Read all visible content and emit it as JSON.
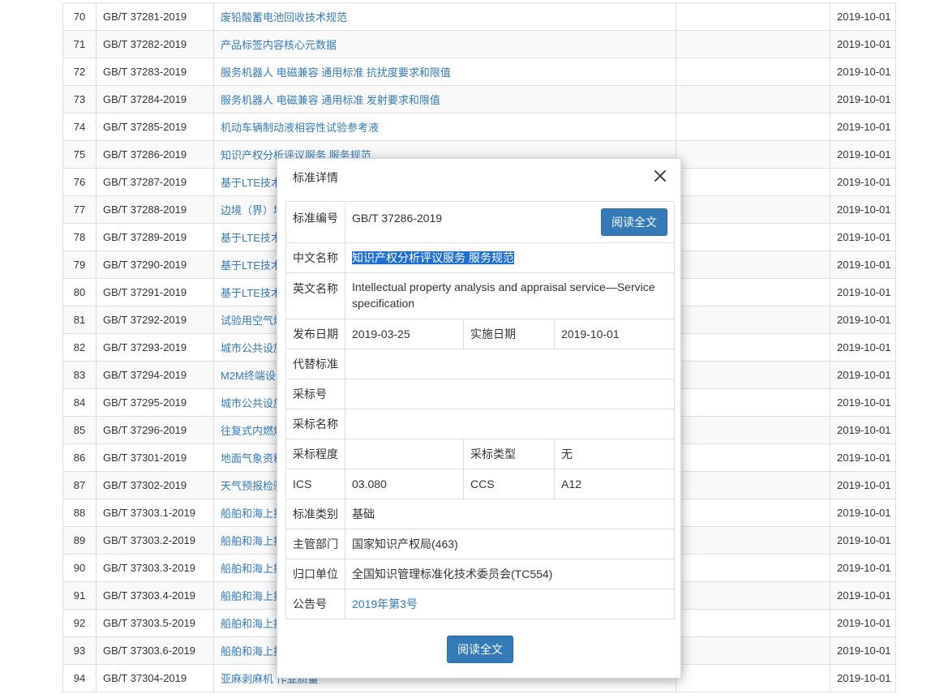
{
  "rows": [
    {
      "no": "70",
      "code": "GB/T 37281-2019",
      "name": "废铅酸蓄电池回收技术规范",
      "date": "2019-10-01"
    },
    {
      "no": "71",
      "code": "GB/T 37282-2019",
      "name": "产品标签内容核心元数据",
      "date": "2019-10-01"
    },
    {
      "no": "72",
      "code": "GB/T 37283-2019",
      "name": "服务机器人 电磁兼容 通用标准 抗扰度要求和限值",
      "date": "2019-10-01"
    },
    {
      "no": "73",
      "code": "GB/T 37284-2019",
      "name": "服务机器人 电磁兼容 通用标准 发射要求和限值",
      "date": "2019-10-01"
    },
    {
      "no": "74",
      "code": "GB/T 37285-2019",
      "name": "机动车辆制动液相容性试验参考液",
      "date": "2019-10-01"
    },
    {
      "no": "75",
      "code": "GB/T 37286-2019",
      "name": "知识产权分析评议服务 服务规范",
      "date": "2019-10-01"
    },
    {
      "no": "76",
      "code": "GB/T 37287-2019",
      "name": "基于LTE技术",
      "date": "2019-10-01"
    },
    {
      "no": "77",
      "code": "GB/T 37288-2019",
      "name": "边境（界）地",
      "date": "2019-10-01"
    },
    {
      "no": "78",
      "code": "GB/T 37289-2019",
      "name": "基于LTE技术",
      "date": "2019-10-01"
    },
    {
      "no": "79",
      "code": "GB/T 37290-2019",
      "name": "基于LTE技术",
      "date": "2019-10-01"
    },
    {
      "no": "80",
      "code": "GB/T 37291-2019",
      "name": "基于LTE技术",
      "date": "2019-10-01"
    },
    {
      "no": "81",
      "code": "GB/T 37292-2019",
      "name": "试验用空气焓",
      "date": "2019-10-01"
    },
    {
      "no": "82",
      "code": "GB/T 37293-2019",
      "name": "城市公共设施",
      "date": "2019-10-01"
    },
    {
      "no": "83",
      "code": "GB/T 37294-2019",
      "name": "M2M终端设备",
      "date": "2019-10-01"
    },
    {
      "no": "84",
      "code": "GB/T 37295-2019",
      "name": "城市公共设施",
      "date": "2019-10-01"
    },
    {
      "no": "85",
      "code": "GB/T 37296-2019",
      "name": "往复式内燃燃",
      "date": "2019-10-01"
    },
    {
      "no": "86",
      "code": "GB/T 37301-2019",
      "name": "地面气象资料",
      "date": "2019-10-01"
    },
    {
      "no": "87",
      "code": "GB/T 37302-2019",
      "name": "天气预报检验",
      "date": "2019-10-01"
    },
    {
      "no": "88",
      "code": "GB/T 37303.1-2019",
      "name": "船舶和海上技",
      "date": "2019-10-01"
    },
    {
      "no": "89",
      "code": "GB/T 37303.2-2019",
      "name": "船舶和海上技",
      "date": "2019-10-01"
    },
    {
      "no": "90",
      "code": "GB/T 37303.3-2019",
      "name": "船舶和海上技",
      "date": "2019-10-01"
    },
    {
      "no": "91",
      "code": "GB/T 37303.4-2019",
      "name": "船舶和海上技",
      "date": "2019-10-01"
    },
    {
      "no": "92",
      "code": "GB/T 37303.5-2019",
      "name": "船舶和海上技",
      "date": "2019-10-01"
    },
    {
      "no": "93",
      "code": "GB/T 37303.6-2019",
      "name": "船舶和海上技",
      "date": "2019-10-01"
    },
    {
      "no": "94",
      "code": "GB/T 37304-2019",
      "name": "亚麻剥麻机 作业质量",
      "date": "2019-10-01"
    }
  ],
  "modal": {
    "title": "标准详情",
    "read_button": "阅读全文",
    "labels": {
      "code": "标准编号",
      "cn_name": "中文名称",
      "en_name": "英文名称",
      "pub_date": "发布日期",
      "impl_date": "实施日期",
      "replace": "代替标准",
      "adopt_no": "采标号",
      "adopt_name": "采标名称",
      "adopt_degree": "采标程度",
      "adopt_type": "采标类型",
      "ics": "ICS",
      "ccs": "CCS",
      "category": "标准类别",
      "dept": "主管部门",
      "unit": "归口单位",
      "notice": "公告号"
    },
    "values": {
      "code": "GB/T 37286-2019",
      "cn_name": "知识产权分析评议服务 服务规范",
      "en_name": "Intellectual property analysis and appraisal service—Service specification",
      "pub_date": "2019-03-25",
      "impl_date": "2019-10-01",
      "replace": "",
      "adopt_no": "",
      "adopt_name": "",
      "adopt_degree": "",
      "adopt_type": "无",
      "ics": "03.080",
      "ccs": "A12",
      "category": "基础",
      "dept": "国家知识产权局(463)",
      "unit": "全国知识管理标准化技术委员会(TC554)",
      "notice": "2019年第3号"
    }
  }
}
